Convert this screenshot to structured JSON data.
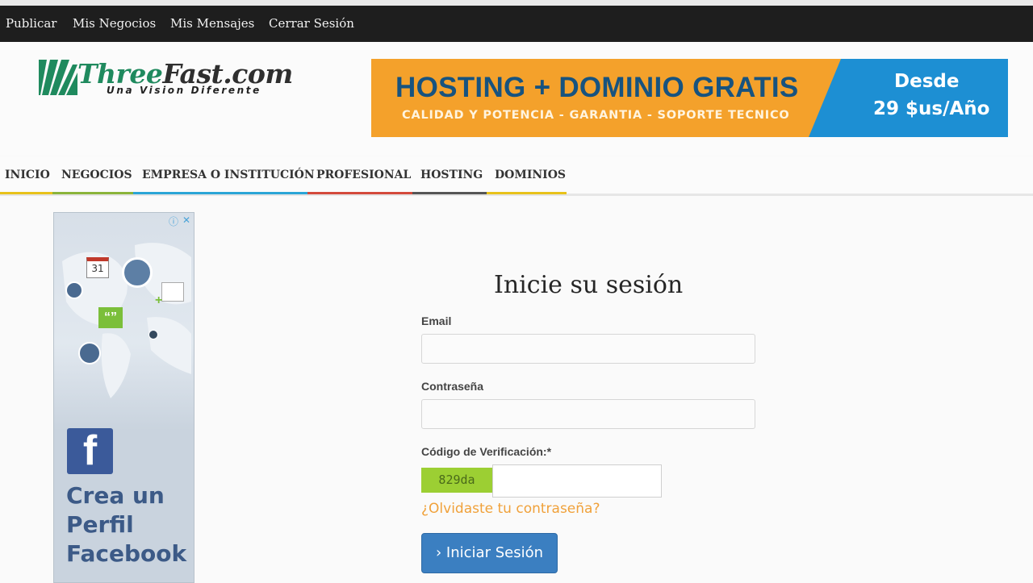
{
  "topbar": {
    "links": [
      "Publicar",
      "Mis Negocios",
      "Mis Mensajes",
      "Cerrar Sesión"
    ]
  },
  "logo": {
    "name_part1": "Three",
    "name_part2": "Fast.com",
    "tagline": "Una Vision Diferente"
  },
  "banner": {
    "headline": "HOSTING + DOMINIO GRATIS",
    "subline": "CALIDAD Y POTENCIA - GARANTIA - SOPORTE TECNICO",
    "price_line1": "Desde",
    "price_line2": "29 $us/Año",
    "colors": {
      "orange": "#f4a12b",
      "blue": "#1d8fd3",
      "text_blue": "#17537f"
    }
  },
  "nav": {
    "items": [
      {
        "label": "INICIO",
        "color": "#e8c21a"
      },
      {
        "label": "NEGOCIOS",
        "color": "#8bb43a"
      },
      {
        "label": "EMPRESA O INSTITUCIÓN",
        "color": "#2aa5d6"
      },
      {
        "label": "PROFESIONAL",
        "color": "#d34a3b"
      },
      {
        "label": "HOSTING",
        "color": "#555555"
      },
      {
        "label": "DOMINIOS",
        "color": "#e8c21a"
      }
    ]
  },
  "ad": {
    "calendar_day": "31",
    "quote_glyph": "“”",
    "facebook_letter": "f",
    "text_lines": [
      "Crea un",
      "Perfil",
      "Facebook"
    ],
    "info_icon": "info-icon",
    "close_icon": "close-icon"
  },
  "login": {
    "title": "Inicie su sesión",
    "email_label": "Email",
    "email_value": "",
    "password_label": "Contraseña",
    "password_value": "",
    "captcha_label": "Código de Verificación:*",
    "captcha_code": "829da",
    "captcha_value": "",
    "forgot_link": "¿Olvidaste tu contraseña?",
    "submit_label": "› Iniciar Sesión"
  }
}
